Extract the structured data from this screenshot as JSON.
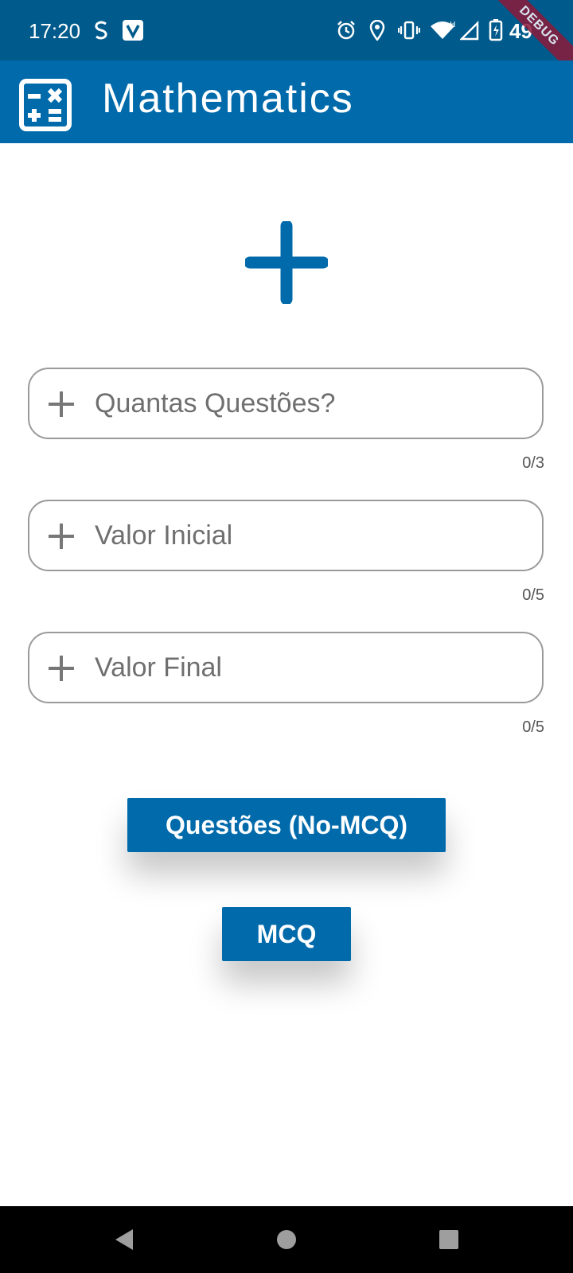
{
  "status_bar": {
    "time": "17:20",
    "battery_text": "49",
    "debug_label": "DEBUG",
    "icons": [
      "sync-icon",
      "v-app-icon",
      "alarm-icon",
      "location-icon",
      "vibrate-icon",
      "wifi-icon",
      "signal-icon",
      "battery-charging-icon"
    ]
  },
  "app_bar": {
    "title": "Mathematics",
    "logo_icon": "calculator-icon",
    "color": "#006aab"
  },
  "hero_icon": "plus-icon",
  "fields": [
    {
      "placeholder": "Quantas Questões?",
      "value": "",
      "counter": "0/3"
    },
    {
      "placeholder": "Valor Inicial",
      "value": "",
      "counter": "0/5"
    },
    {
      "placeholder": "Valor Final",
      "value": "",
      "counter": "0/5"
    }
  ],
  "buttons": {
    "non_mcq_label": "Questões (No-MCQ)",
    "mcq_label": "MCQ"
  },
  "nav_bar": {
    "icons": [
      "back-icon",
      "home-icon",
      "recents-icon"
    ]
  },
  "colors": {
    "status_bar": "#005a8c",
    "primary": "#006aab",
    "nav_bar": "#000000"
  }
}
